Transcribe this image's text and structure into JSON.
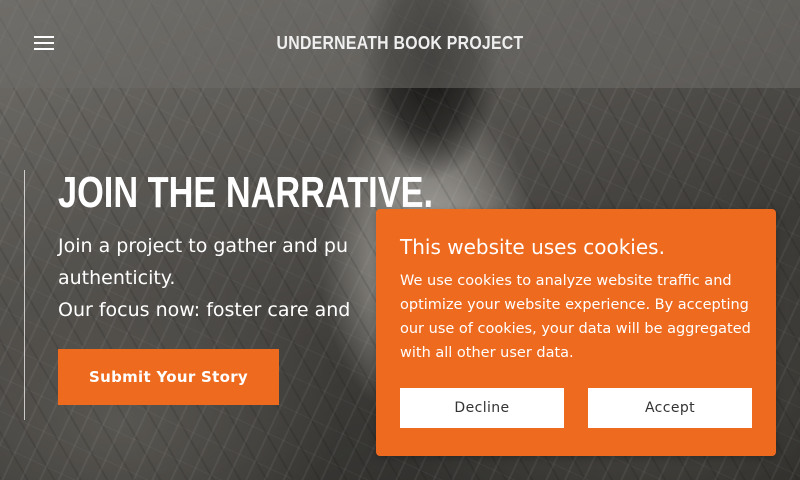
{
  "header": {
    "menu_icon": "hamburger-menu-icon",
    "site_title": "UNDERNEATH BOOK PROJECT"
  },
  "hero": {
    "headline": "JOIN THE NARRATIVE.",
    "intro_line1": "Join a project to gather and pu",
    "intro_line2": "authenticity.",
    "intro_line3": "Our focus now: foster care and",
    "submit_label": "Submit Your Story"
  },
  "cookie_banner": {
    "title": "This website uses cookies.",
    "message": "We use cookies to analyze website traffic and optimize your website experience. By accepting our use of cookies, your data will be aggregated with all other user data.",
    "decline_label": "Decline",
    "accept_label": "Accept"
  },
  "colors": {
    "accent": "#ee6a1f",
    "text_light": "#ffffff"
  }
}
